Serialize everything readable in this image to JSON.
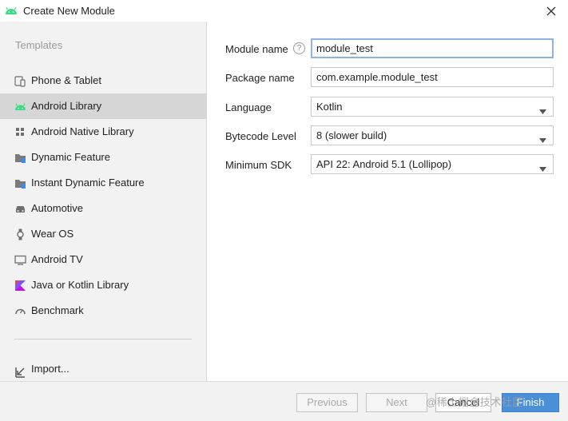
{
  "window": {
    "title": "Create New Module",
    "app_icon": "android-icon",
    "close_icon": "close-icon"
  },
  "sidebar": {
    "heading": "Templates",
    "items": [
      {
        "label": "Phone & Tablet",
        "icon": "phone-tablet-icon",
        "selected": false
      },
      {
        "label": "Android Library",
        "icon": "android-icon",
        "selected": true
      },
      {
        "label": "Android Native Library",
        "icon": "native-library-icon",
        "selected": false
      },
      {
        "label": "Dynamic Feature",
        "icon": "folder-icon",
        "selected": false
      },
      {
        "label": "Instant Dynamic Feature",
        "icon": "folder-icon",
        "selected": false
      },
      {
        "label": "Automotive",
        "icon": "car-icon",
        "selected": false
      },
      {
        "label": "Wear OS",
        "icon": "watch-icon",
        "selected": false
      },
      {
        "label": "Android TV",
        "icon": "tv-icon",
        "selected": false
      },
      {
        "label": "Java or Kotlin Library",
        "icon": "kotlin-icon",
        "selected": false
      },
      {
        "label": "Benchmark",
        "icon": "gauge-icon",
        "selected": false
      }
    ],
    "import_label": "Import..."
  },
  "form": {
    "module_name": {
      "label": "Module name",
      "value": "module_test",
      "help": "?"
    },
    "package_name": {
      "label": "Package name",
      "value": "com.example.module_test"
    },
    "language": {
      "label": "Language",
      "value": "Kotlin"
    },
    "bytecode_level": {
      "label": "Bytecode Level",
      "value": "8 (slower build)"
    },
    "minimum_sdk": {
      "label": "Minimum SDK",
      "value": "API 22: Android 5.1 (Lollipop)"
    }
  },
  "buttons": {
    "previous": "Previous",
    "next": "Next",
    "cancel": "Cancel",
    "finish": "Finish"
  },
  "watermark": "@稀土掘金技术社区",
  "colors": {
    "accent": "#4a8fd8",
    "selected_row": "#d6d6d6",
    "android_green": "#3ddc84",
    "focus_border": "#8db2e3"
  }
}
